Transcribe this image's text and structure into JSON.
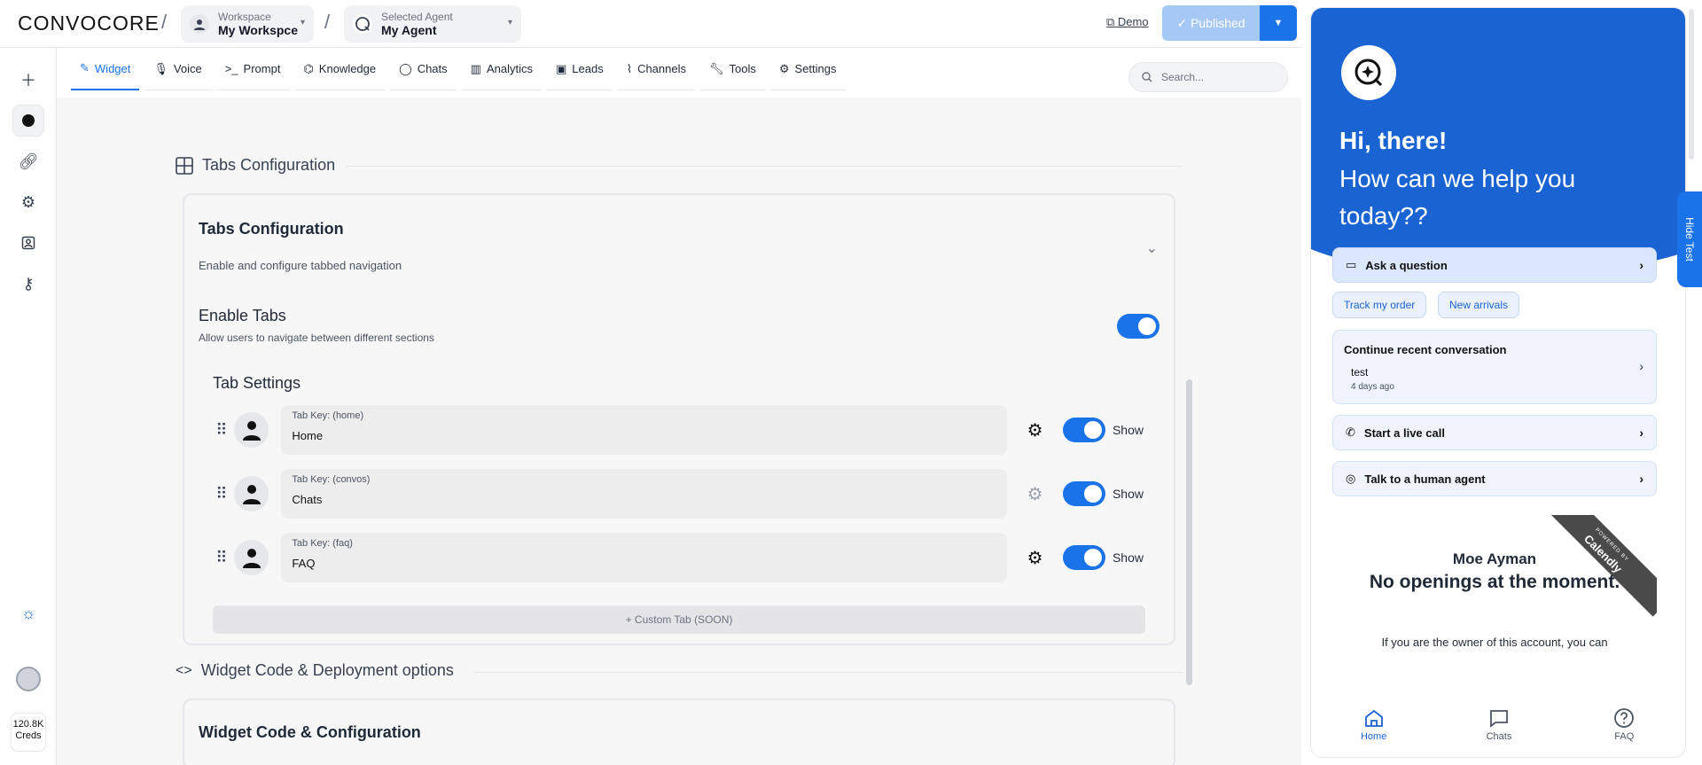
{
  "brand": {
    "logo_text": "CONVOCORE"
  },
  "header": {
    "workspace_label": "Workspace",
    "workspace_value": "My Workspce",
    "agent_label": "Selected Agent",
    "agent_value": "My Agent",
    "demo_label": "Demo",
    "publish_label": "Published"
  },
  "rail": {
    "creds_value": "120.8K",
    "creds_label": "Creds"
  },
  "tabs": [
    {
      "label": "Widget",
      "icon": "widget-icon"
    },
    {
      "label": "Voice",
      "icon": "mic-icon"
    },
    {
      "label": "Prompt",
      "icon": "terminal-icon"
    },
    {
      "label": "Knowledge",
      "icon": "brain-icon"
    },
    {
      "label": "Chats",
      "icon": "chat-icon"
    },
    {
      "label": "Analytics",
      "icon": "bar-chart-icon"
    },
    {
      "label": "Leads",
      "icon": "contact-icon"
    },
    {
      "label": "Channels",
      "icon": "channels-icon"
    },
    {
      "label": "Tools",
      "icon": "wrench-icon"
    },
    {
      "label": "Settings",
      "icon": "gear-icon"
    }
  ],
  "search": {
    "placeholder": "Search..."
  },
  "section1": {
    "title": "Tabs Configuration"
  },
  "card": {
    "title": "Tabs Configuration",
    "description": "Enable and configure tabbed navigation",
    "enable_title": "Enable Tabs",
    "enable_desc": "Allow users to navigate between different sections",
    "tab_settings_title": "Tab Settings",
    "rows": [
      {
        "key": "Tab Key: (home)",
        "value": "Home",
        "show": "Show"
      },
      {
        "key": "Tab Key: (convos)",
        "value": "Chats",
        "show": "Show"
      },
      {
        "key": "Tab Key: (faq)",
        "value": "FAQ",
        "show": "Show"
      }
    ],
    "custom_tab": "+ Custom Tab (SOON)"
  },
  "section2": {
    "title": "Widget Code & Deployment options"
  },
  "card2": {
    "title": "Widget Code & Configuration"
  },
  "widget": {
    "greeting": "Hi, there!",
    "help": "How can we help you today??",
    "ask": "Ask a question",
    "chips": [
      "Track my order",
      "New arrivals"
    ],
    "recent_title": "Continue recent conversation",
    "recent_name": "test",
    "recent_date": "4 days ago",
    "live_call": "Start a live call",
    "human": "Talk to a human agent",
    "calendly_powered": "POWERED BY",
    "calendly_brand": "Calendly",
    "calendly_name": "Moe Ayman",
    "calendly_noop": "No openings at the moment.",
    "calendly_owner": "If you are the owner of this account, you can",
    "nav": [
      "Home",
      "Chats",
      "FAQ"
    ],
    "hide_test": "Hide Test"
  },
  "colors": {
    "accent": "#1a73e8",
    "hero": "#1a63d2"
  }
}
